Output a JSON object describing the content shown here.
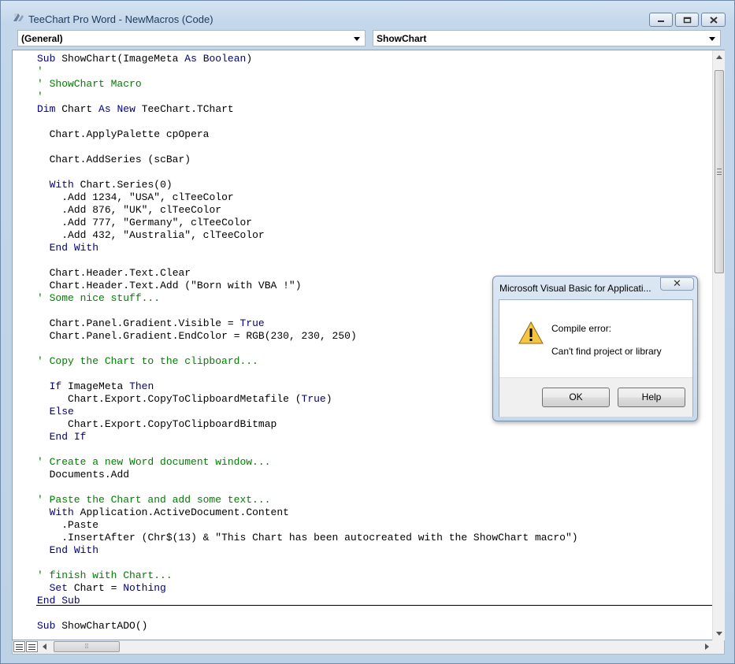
{
  "window": {
    "title": "TeeChart Pro Word - NewMacros (Code)"
  },
  "object_combo": {
    "value": "(General)"
  },
  "procedure_combo": {
    "value": "ShowChart"
  },
  "code_lines": [
    "Sub ShowChart(ImageMeta As Boolean)",
    "'",
    "' ShowChart Macro",
    "'",
    "Dim Chart As New TeeChart.TChart",
    "",
    "  Chart.ApplyPalette cpOpera",
    "",
    "  Chart.AddSeries (scBar)",
    "",
    "  With Chart.Series(0)",
    "    .Add 1234, \"USA\", clTeeColor",
    "    .Add 876, \"UK\", clTeeColor",
    "    .Add 777, \"Germany\", clTeeColor",
    "    .Add 432, \"Australia\", clTeeColor",
    "  End With",
    "",
    "  Chart.Header.Text.Clear",
    "  Chart.Header.Text.Add (\"Born with VBA !\")",
    "' Some nice stuff...",
    "",
    "  Chart.Panel.Gradient.Visible = True",
    "  Chart.Panel.Gradient.EndColor = RGB(230, 230, 250)",
    "",
    "' Copy the Chart to the clipboard...",
    "",
    "  If ImageMeta Then",
    "     Chart.Export.CopyToClipboardMetafile (True)",
    "  Else",
    "     Chart.Export.CopyToClipboardBitmap",
    "  End If",
    "",
    "' Create a new Word document window...",
    "  Documents.Add",
    "",
    "' Paste the Chart and add some text...",
    "  With Application.ActiveDocument.Content",
    "    .Paste",
    "    .InsertAfter (Chr$(13) & \"This Chart has been autocreated with the ShowChart macro\")",
    "  End With",
    "",
    "' finish with Chart...",
    "  Set Chart = Nothing",
    "End Sub"
  ],
  "code_lines_2": [
    "Sub ShowChartADO()"
  ],
  "dialog": {
    "title": "Microsoft Visual Basic for Applicati...",
    "close_label": "✕",
    "message_line1": "Compile error:",
    "message_line2": "Can't find project or library",
    "ok_label": "OK",
    "help_label": "Help"
  },
  "colors": {
    "keyword": "#000080",
    "comment": "#008000"
  }
}
